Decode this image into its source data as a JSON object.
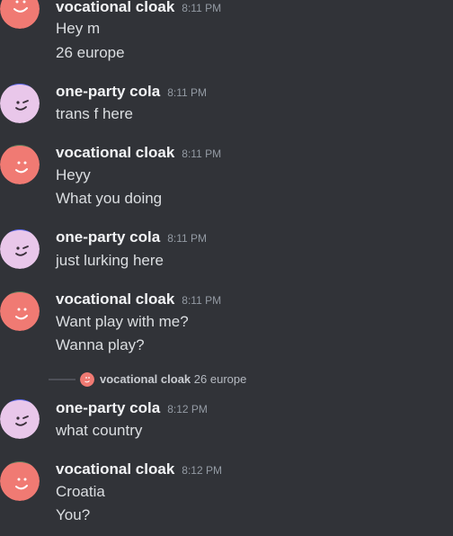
{
  "messages": [
    {
      "author": "vocational cloak",
      "time": "8:11 PM",
      "avatar": "red",
      "lines": [
        "Hey m",
        "26 europe"
      ]
    },
    {
      "author": "one-party cola",
      "time": "8:11 PM",
      "avatar": "lavender",
      "lines": [
        "trans f here"
      ]
    },
    {
      "author": "vocational cloak",
      "time": "8:11 PM",
      "avatar": "red",
      "lines": [
        "Heyy",
        "What you doing"
      ]
    },
    {
      "author": "one-party cola",
      "time": "8:11 PM",
      "avatar": "lavender",
      "lines": [
        "just lurking here"
      ]
    },
    {
      "author": "vocational cloak",
      "time": "8:11 PM",
      "avatar": "red",
      "lines": [
        "Want play with me?",
        "Wanna play?"
      ]
    },
    {
      "author": "one-party cola",
      "time": "8:12 PM",
      "avatar": "lavender",
      "lines": [
        "what country"
      ]
    },
    {
      "author": "vocational cloak",
      "time": "8:12 PM",
      "avatar": "red",
      "lines": [
        "Croatia",
        "You?"
      ]
    }
  ],
  "reply": {
    "author": "vocational cloak",
    "text": "26 europe"
  },
  "colors": {
    "background": "#313338",
    "red_avatar": "#f07a73",
    "lavender_avatar": "#e9c7ea"
  }
}
